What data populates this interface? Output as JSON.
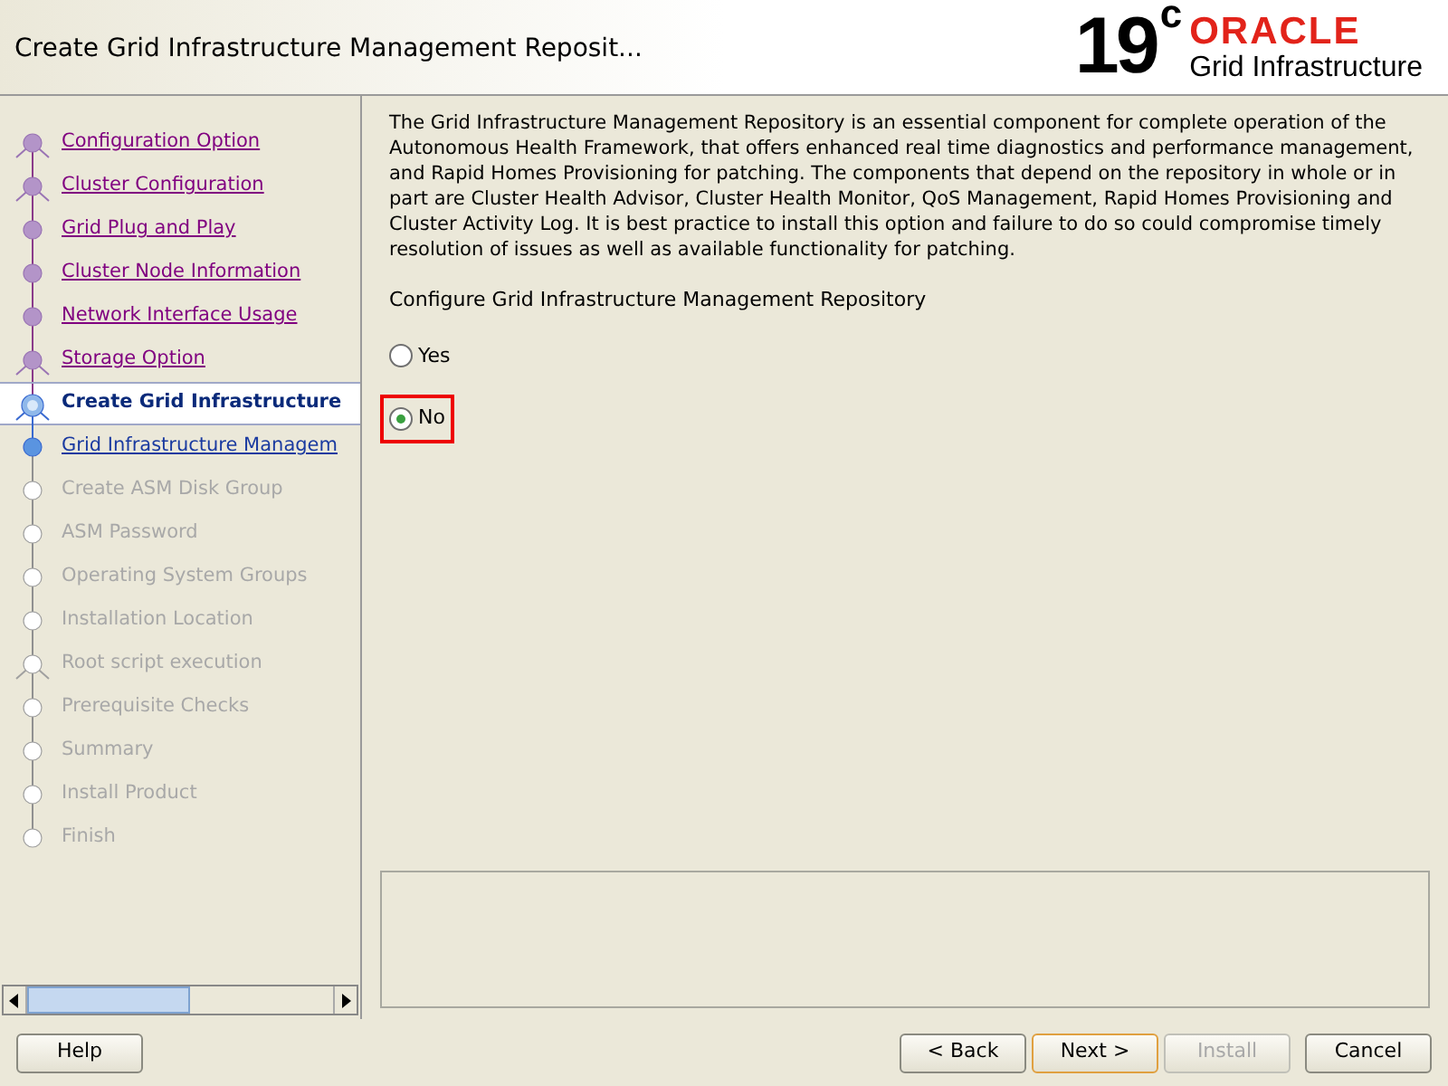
{
  "window": {
    "title": "Create Grid Infrastructure Management Reposit..."
  },
  "logo": {
    "version": "19",
    "version_suffix": "c",
    "brand": "ORACLE",
    "product": "Grid Infrastructure"
  },
  "steps": [
    {
      "label": "Configuration Option",
      "visited": true,
      "selected": false,
      "disabled": false,
      "branch": true
    },
    {
      "label": "Cluster Configuration",
      "visited": true,
      "selected": false,
      "disabled": false,
      "branch": true
    },
    {
      "label": "Grid Plug and Play",
      "visited": true,
      "selected": false,
      "disabled": false,
      "branch": false
    },
    {
      "label": "Cluster Node Information",
      "visited": true,
      "selected": false,
      "disabled": false,
      "branch": false
    },
    {
      "label": "Network Interface Usage",
      "visited": true,
      "selected": false,
      "disabled": false,
      "branch": false
    },
    {
      "label": "Storage Option",
      "visited": true,
      "selected": false,
      "disabled": false,
      "branch": true
    },
    {
      "label": "Create Grid Infrastructure",
      "visited": false,
      "selected": true,
      "disabled": false,
      "branch": true
    },
    {
      "label": "Grid Infrastructure Managem",
      "visited": false,
      "selected": false,
      "disabled": false,
      "branch": false
    },
    {
      "label": "Create ASM Disk Group",
      "visited": false,
      "selected": false,
      "disabled": true,
      "branch": false
    },
    {
      "label": "ASM Password",
      "visited": false,
      "selected": false,
      "disabled": true,
      "branch": false
    },
    {
      "label": "Operating System Groups",
      "visited": false,
      "selected": false,
      "disabled": true,
      "branch": false
    },
    {
      "label": "Installation Location",
      "visited": false,
      "selected": false,
      "disabled": true,
      "branch": false
    },
    {
      "label": "Root script execution",
      "visited": false,
      "selected": false,
      "disabled": true,
      "branch": true
    },
    {
      "label": "Prerequisite Checks",
      "visited": false,
      "selected": false,
      "disabled": true,
      "branch": false
    },
    {
      "label": "Summary",
      "visited": false,
      "selected": false,
      "disabled": true,
      "branch": false
    },
    {
      "label": "Install Product",
      "visited": false,
      "selected": false,
      "disabled": true,
      "branch": false
    },
    {
      "label": "Finish",
      "visited": false,
      "selected": false,
      "disabled": true,
      "branch": false
    }
  ],
  "description": "The Grid Infrastructure Management Repository is an essential component for complete operation of the Autonomous Health Framework, that offers enhanced real time diagnostics and performance management, and Rapid Homes Provisioning for patching. The components that depend on the repository in whole or in part are Cluster Health Advisor, Cluster Health Monitor, QoS Management, Rapid Homes Provisioning and Cluster Activity Log.  It is best practice to install this option and failure to do so could compromise timely resolution of issues as well as available functionality for patching.",
  "question": "Configure Grid Infrastructure Management Repository",
  "options": [
    {
      "label": "Yes",
      "selected": false
    },
    {
      "label": "No",
      "selected": true
    }
  ],
  "buttons": [
    {
      "label": "Help",
      "kind": "help",
      "disabled": false,
      "focused": false
    },
    {
      "label": "< Back",
      "kind": "nav",
      "disabled": false,
      "focused": false
    },
    {
      "label": "Next >",
      "kind": "nav",
      "disabled": false,
      "focused": true
    },
    {
      "label": "Install",
      "kind": "nav",
      "disabled": true,
      "focused": false
    },
    {
      "label": "Cancel",
      "kind": "cancel",
      "disabled": false,
      "focused": false
    }
  ]
}
